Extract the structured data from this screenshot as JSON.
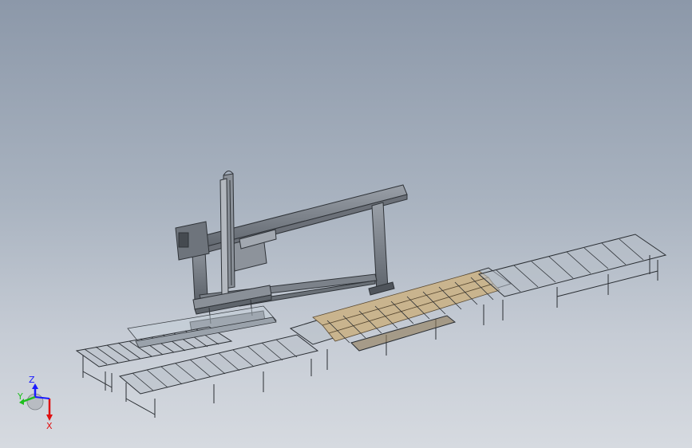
{
  "triad": {
    "z_label": "Z",
    "y_label": "Y",
    "x_label": "X",
    "z_color": "#1a1aff",
    "y_color": "#1fbf1f",
    "x_color": "#e01010"
  },
  "scene": {
    "background_top": "#8c98a9",
    "background_bottom": "#d6dae0",
    "model": "gantry-robot-with-roller-conveyors"
  }
}
